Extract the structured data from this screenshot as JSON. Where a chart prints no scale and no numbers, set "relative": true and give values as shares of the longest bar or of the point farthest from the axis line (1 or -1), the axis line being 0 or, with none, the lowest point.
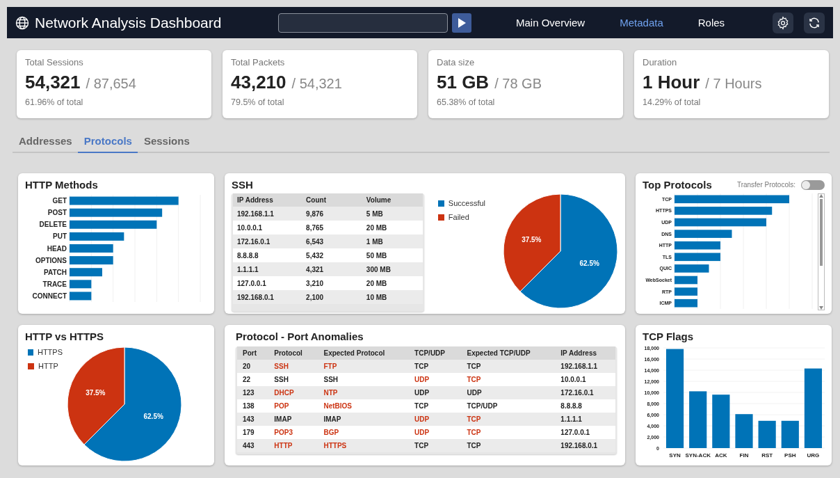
{
  "header": {
    "title": "Network Analysis Dashboard",
    "nav": [
      {
        "label": "Main Overview",
        "selected": false
      },
      {
        "label": "Metadata",
        "selected": true
      },
      {
        "label": "Roles",
        "selected": false
      }
    ]
  },
  "stats": [
    {
      "label": "Total Sessions",
      "value": "54,321",
      "total": "/ 87,654",
      "note": "61.96% of total"
    },
    {
      "label": "Total Packets",
      "value": "43,210",
      "total": "/ 54,321",
      "note": "79.5% of total"
    },
    {
      "label": "Data size",
      "value": "51 GB",
      "total": "/ 78 GB",
      "note": "65.38% of total"
    },
    {
      "label": "Duration",
      "value": "1 Hour",
      "total": "/ 7 Hours",
      "note": "14.29% of total"
    }
  ],
  "tabs": [
    {
      "label": "Addresses",
      "selected": false
    },
    {
      "label": "Protocols",
      "selected": true
    },
    {
      "label": "Sessions",
      "selected": false
    }
  ],
  "http_methods": {
    "title": "HTTP Methods",
    "chart_data": {
      "type": "bar",
      "orientation": "horizontal",
      "categories": [
        "GET",
        "POST",
        "DELETE",
        "PUT",
        "HEAD",
        "OPTIONS",
        "PATCH",
        "TRACE",
        "CONNECT"
      ],
      "values": [
        1,
        0.85,
        0.8,
        0.5,
        0.4,
        0.4,
        0.3,
        0.2,
        0.2
      ],
      "relative": true,
      "grid": true
    }
  },
  "ssh": {
    "title": "SSH",
    "table": {
      "columns": [
        "IP Address",
        "Count",
        "Volume"
      ],
      "rows": [
        [
          "192.168.1.1",
          "9,876",
          "5 MB"
        ],
        [
          "10.0.0.1",
          "8,765",
          "20 MB"
        ],
        [
          "172.16.0.1",
          "6,543",
          "1 MB"
        ],
        [
          "8.8.8.8",
          "5,432",
          "50 MB"
        ],
        [
          "1.1.1.1",
          "4,321",
          "300 MB"
        ],
        [
          "127.0.0.1",
          "3,210",
          "20 MB"
        ],
        [
          "192.168.0.1",
          "2,100",
          "10 MB"
        ]
      ]
    },
    "chart_data": {
      "type": "pie",
      "categories": [
        "Successful",
        "Failed"
      ],
      "values": [
        62.5,
        37.5
      ],
      "colors": [
        "#0073b7",
        "#cc3311"
      ],
      "value_labels": [
        "62.5%",
        "37.5%"
      ]
    }
  },
  "top_protocols": {
    "title": "Top Protocols",
    "toggle": {
      "label": "Transfer Protocols:",
      "on": false
    },
    "chart_data": {
      "type": "bar",
      "orientation": "horizontal",
      "categories": [
        "TCP",
        "HTTPS",
        "UDP",
        "DNS",
        "HTTP",
        "TLS",
        "QUIC",
        "WebSocket",
        "RTP",
        "ICMP"
      ],
      "values": [
        1,
        0.85,
        0.8,
        0.5,
        0.4,
        0.4,
        0.3,
        0.2,
        0.2,
        0.2
      ],
      "relative": true,
      "grid": true
    }
  },
  "http_vs_https": {
    "title": "HTTP vs HTTPS",
    "chart_data": {
      "type": "pie",
      "categories": [
        "HTTPS",
        "HTTP"
      ],
      "values": [
        62.5,
        37.5
      ],
      "colors": [
        "#0073b7",
        "#cc3311"
      ],
      "value_labels": [
        "62.5%",
        "37.5%"
      ]
    }
  },
  "anomalies": {
    "title": "Protocol - Port Anomalies",
    "columns": [
      "Port",
      "Protocol",
      "Expected Protocol",
      "TCP/UDP",
      "Expected TCP/UDP",
      "IP Address"
    ],
    "rows": [
      {
        "port": "20",
        "protocol": "SSH",
        "expected_protocol": "FTP",
        "tcp_udp": "TCP",
        "expected_tcp_udp": "TCP",
        "ip": "192.168.1.1",
        "protocol_mismatch": true,
        "transport_mismatch": false
      },
      {
        "port": "22",
        "protocol": "SSH",
        "expected_protocol": "SSH",
        "tcp_udp": "UDP",
        "expected_tcp_udp": "TCP",
        "ip": "10.0.0.1",
        "protocol_mismatch": false,
        "transport_mismatch": true
      },
      {
        "port": "123",
        "protocol": "DHCP",
        "expected_protocol": "NTP",
        "tcp_udp": "UDP",
        "expected_tcp_udp": "UDP",
        "ip": "172.16.0.1",
        "protocol_mismatch": true,
        "transport_mismatch": false
      },
      {
        "port": "138",
        "protocol": "POP",
        "expected_protocol": "NetBIOS",
        "tcp_udp": "TCP",
        "expected_tcp_udp": "TCP/UDP",
        "ip": "8.8.8.8",
        "protocol_mismatch": true,
        "transport_mismatch": false
      },
      {
        "port": "143",
        "protocol": "IMAP",
        "expected_protocol": "IMAP",
        "tcp_udp": "UDP",
        "expected_tcp_udp": "TCP",
        "ip": "1.1.1.1",
        "protocol_mismatch": false,
        "transport_mismatch": true
      },
      {
        "port": "179",
        "protocol": "POP3",
        "expected_protocol": "BGP",
        "tcp_udp": "UDP",
        "expected_tcp_udp": "TCP",
        "ip": "127.0.0.1",
        "protocol_mismatch": true,
        "transport_mismatch": true
      },
      {
        "port": "443",
        "protocol": "HTTP",
        "expected_protocol": "HTTPS",
        "tcp_udp": "TCP",
        "expected_tcp_udp": "TCP",
        "ip": "192.168.0.1",
        "protocol_mismatch": true,
        "transport_mismatch": false
      }
    ]
  },
  "tcp_flags": {
    "title": "TCP Flags",
    "chart_data": {
      "type": "bar",
      "categories": [
        "SYN",
        "SYN-ACK",
        "ACK",
        "FIN",
        "RST",
        "PSH",
        "URG"
      ],
      "values": [
        17800,
        10200,
        9600,
        6100,
        4900,
        4900,
        14300
      ],
      "ylim": [
        0,
        18000
      ],
      "grid": true,
      "yticks": [
        {
          "value": 0,
          "label": "0"
        },
        {
          "value": 2000,
          "label": "2,000"
        },
        {
          "value": 4000,
          "label": "4,000"
        },
        {
          "value": 6000,
          "label": "6,000"
        },
        {
          "value": 8000,
          "label": "8,000"
        },
        {
          "value": 10000,
          "label": "10,000"
        },
        {
          "value": 12000,
          "label": "12,000"
        },
        {
          "value": 14000,
          "label": "14,000"
        },
        {
          "value": 16000,
          "label": "16,000"
        },
        {
          "value": 18000,
          "label": "18,000"
        }
      ]
    }
  }
}
